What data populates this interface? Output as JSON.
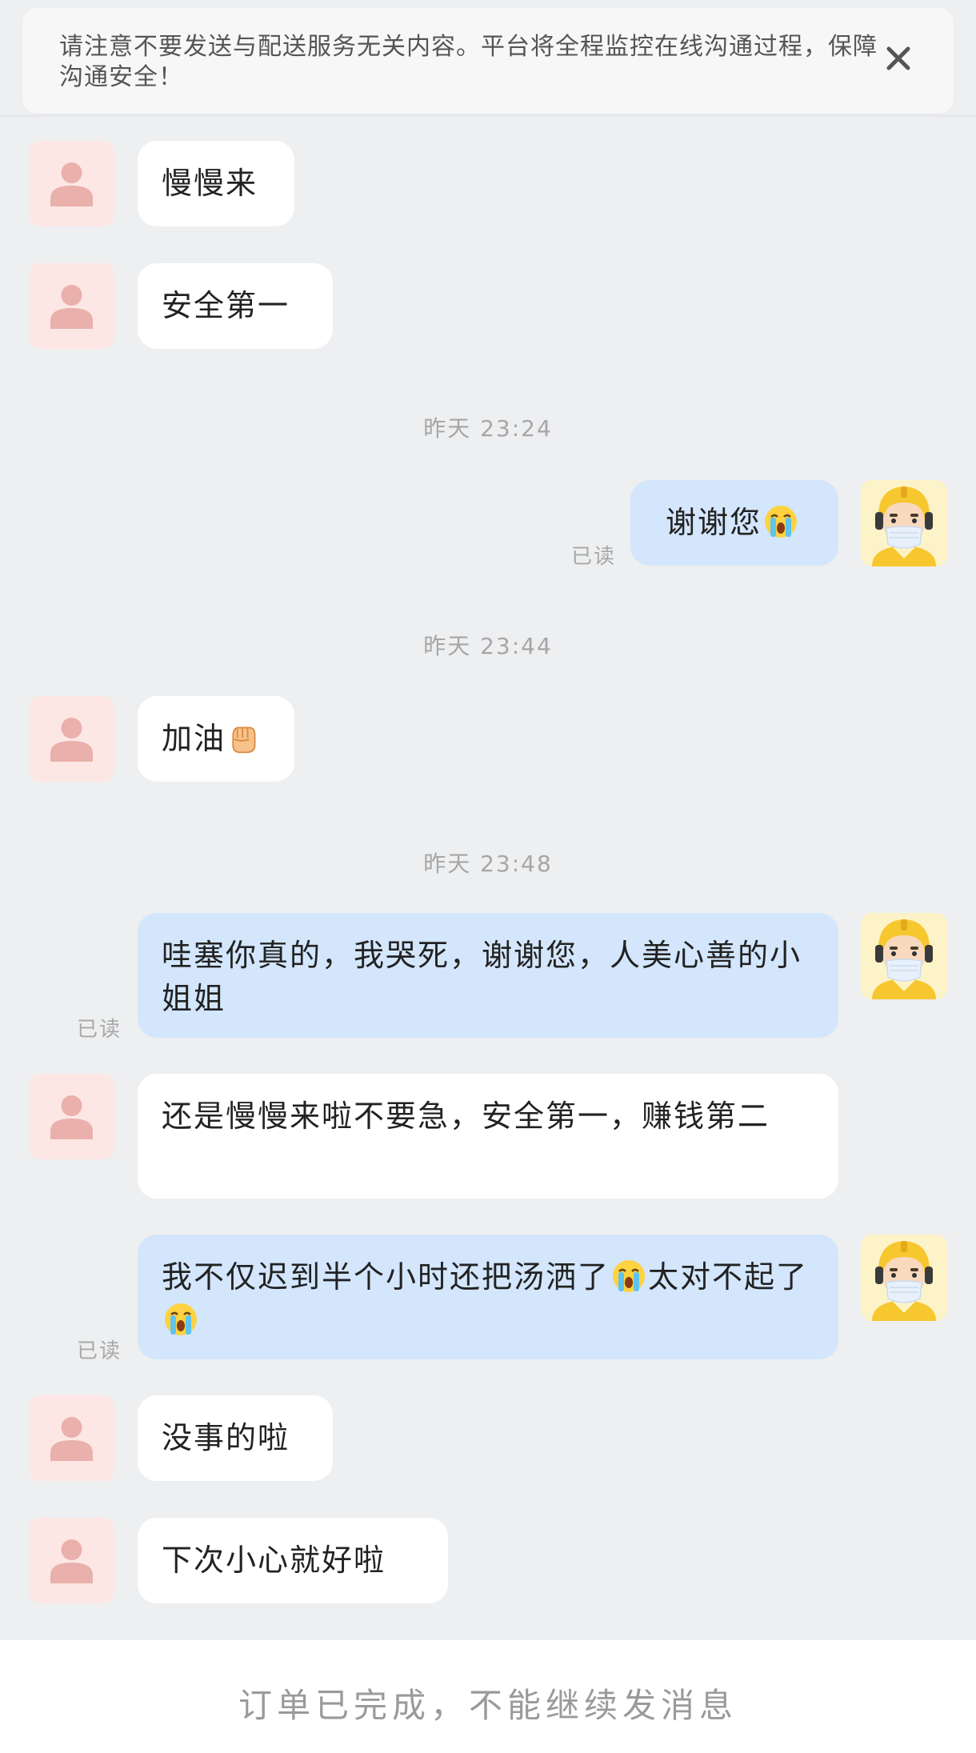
{
  "notice": {
    "text": "请注意不要发送与配送服务无关内容。平台将全程监控在线沟通过程，保障沟通安全！"
  },
  "messages": [
    {
      "text": "慢慢来"
    },
    {
      "text": "安全第一"
    },
    {
      "time": "昨天 23:24"
    },
    {
      "text": "谢谢您",
      "read": "已读"
    },
    {
      "time": "昨天 23:44"
    },
    {
      "text": "加油"
    },
    {
      "time": "昨天 23:48"
    },
    {
      "text": "哇塞你真的，我哭死，谢谢您，人美心善的小姐姐",
      "read": "已读"
    },
    {
      "text": "还是慢慢来啦不要急，安全第一，赚钱第二"
    },
    {
      "text_a": "我不仅迟到半个小时还把汤洒了",
      "text_b": "太对不起了",
      "read": "已读"
    },
    {
      "text": "没事的啦"
    },
    {
      "text": "下次小心就好啦"
    }
  ],
  "footer": {
    "text": "订单已完成，不能继续发消息"
  },
  "colors": {
    "background": "#eeeff1",
    "incoming_bubble": "#ffffff",
    "outgoing_bubble": "#d3e6fc",
    "user_avatar_bg": "#fde7e4",
    "user_avatar_figure": "#eab0ac",
    "rider_helmet": "#f7c72f"
  },
  "icons": {
    "close": "close-icon",
    "user_avatar": "user-silhouette-icon",
    "rider_avatar": "delivery-rider-icon",
    "crying_emoji": "crying-face-emoji",
    "fist_emoji": "raised-fist-emoji"
  }
}
